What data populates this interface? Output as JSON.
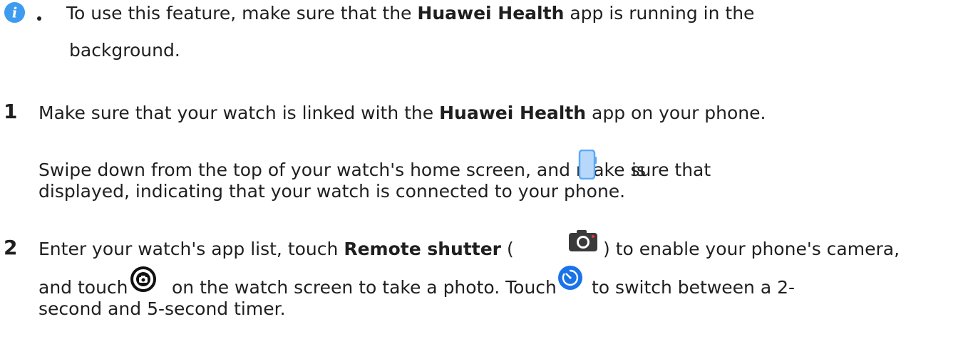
{
  "note": {
    "line1_pre": "To use this feature, make sure that the ",
    "line1_bold": "Huawei Health",
    "line1_post": " app is running in the",
    "line2": "background."
  },
  "steps": [
    {
      "number": "1",
      "l1_pre": "Make sure that your watch is linked with the ",
      "l1_bold": "Huawei Health",
      "l1_post": " app on your phone.",
      "l2_pre": "Swipe down from the top of your watch's home screen, and make sure that",
      "l2_post": "is",
      "l3": "displayed, indicating that your watch is connected to your phone."
    },
    {
      "number": "2",
      "l1_pre": "Enter your watch's app list, touch ",
      "l1_bold": "Remote shutter",
      "l1_mid": " (",
      "l1_post": ") to enable your phone's camera,",
      "l2_pre": "and touch",
      "l2_mid": "on the watch screen to take a photo. Touch",
      "l2_post": "to switch between a 2-",
      "l3": "second and 5-second timer."
    }
  ],
  "icons": {
    "info": "info-icon",
    "phone_connected": "phone-connected-icon",
    "remote_shutter": "camera-app-icon",
    "shutter": "shutter-button-icon",
    "timer": "timer-icon",
    "info_color": "#2f8ee8",
    "timer_color": "#1a73e8"
  }
}
